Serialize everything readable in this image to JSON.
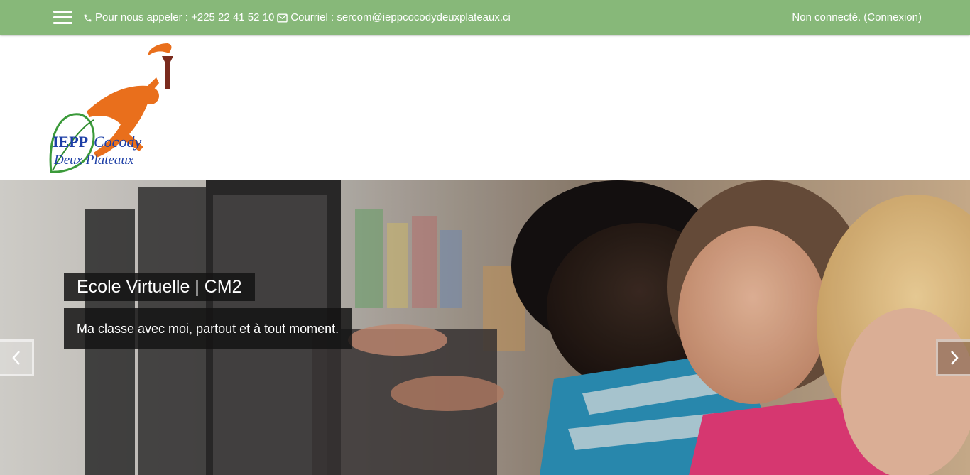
{
  "topbar": {
    "phone_text": "Pour nous appeler : +225 22 41 52 10",
    "email_text": "Courriel : sercom@ieppcocodydeuxplateaux.ci",
    "login_status": "Non connecté.",
    "login_link": "(Connexion)",
    "background_color": "#87b879"
  },
  "logo": {
    "line1": "IEPP",
    "line2": "Cocody",
    "line3": "Deux Plateaux"
  },
  "hero": {
    "title": "Ecole Virtuelle | CM2",
    "subtitle": "Ma classe avec moi, partout et à tout moment.",
    "prev_icon": "chevron-left-icon",
    "next_icon": "chevron-right-icon"
  },
  "icons": {
    "menu": "hamburger-menu-icon",
    "phone": "phone-icon",
    "email": "envelope-icon"
  }
}
